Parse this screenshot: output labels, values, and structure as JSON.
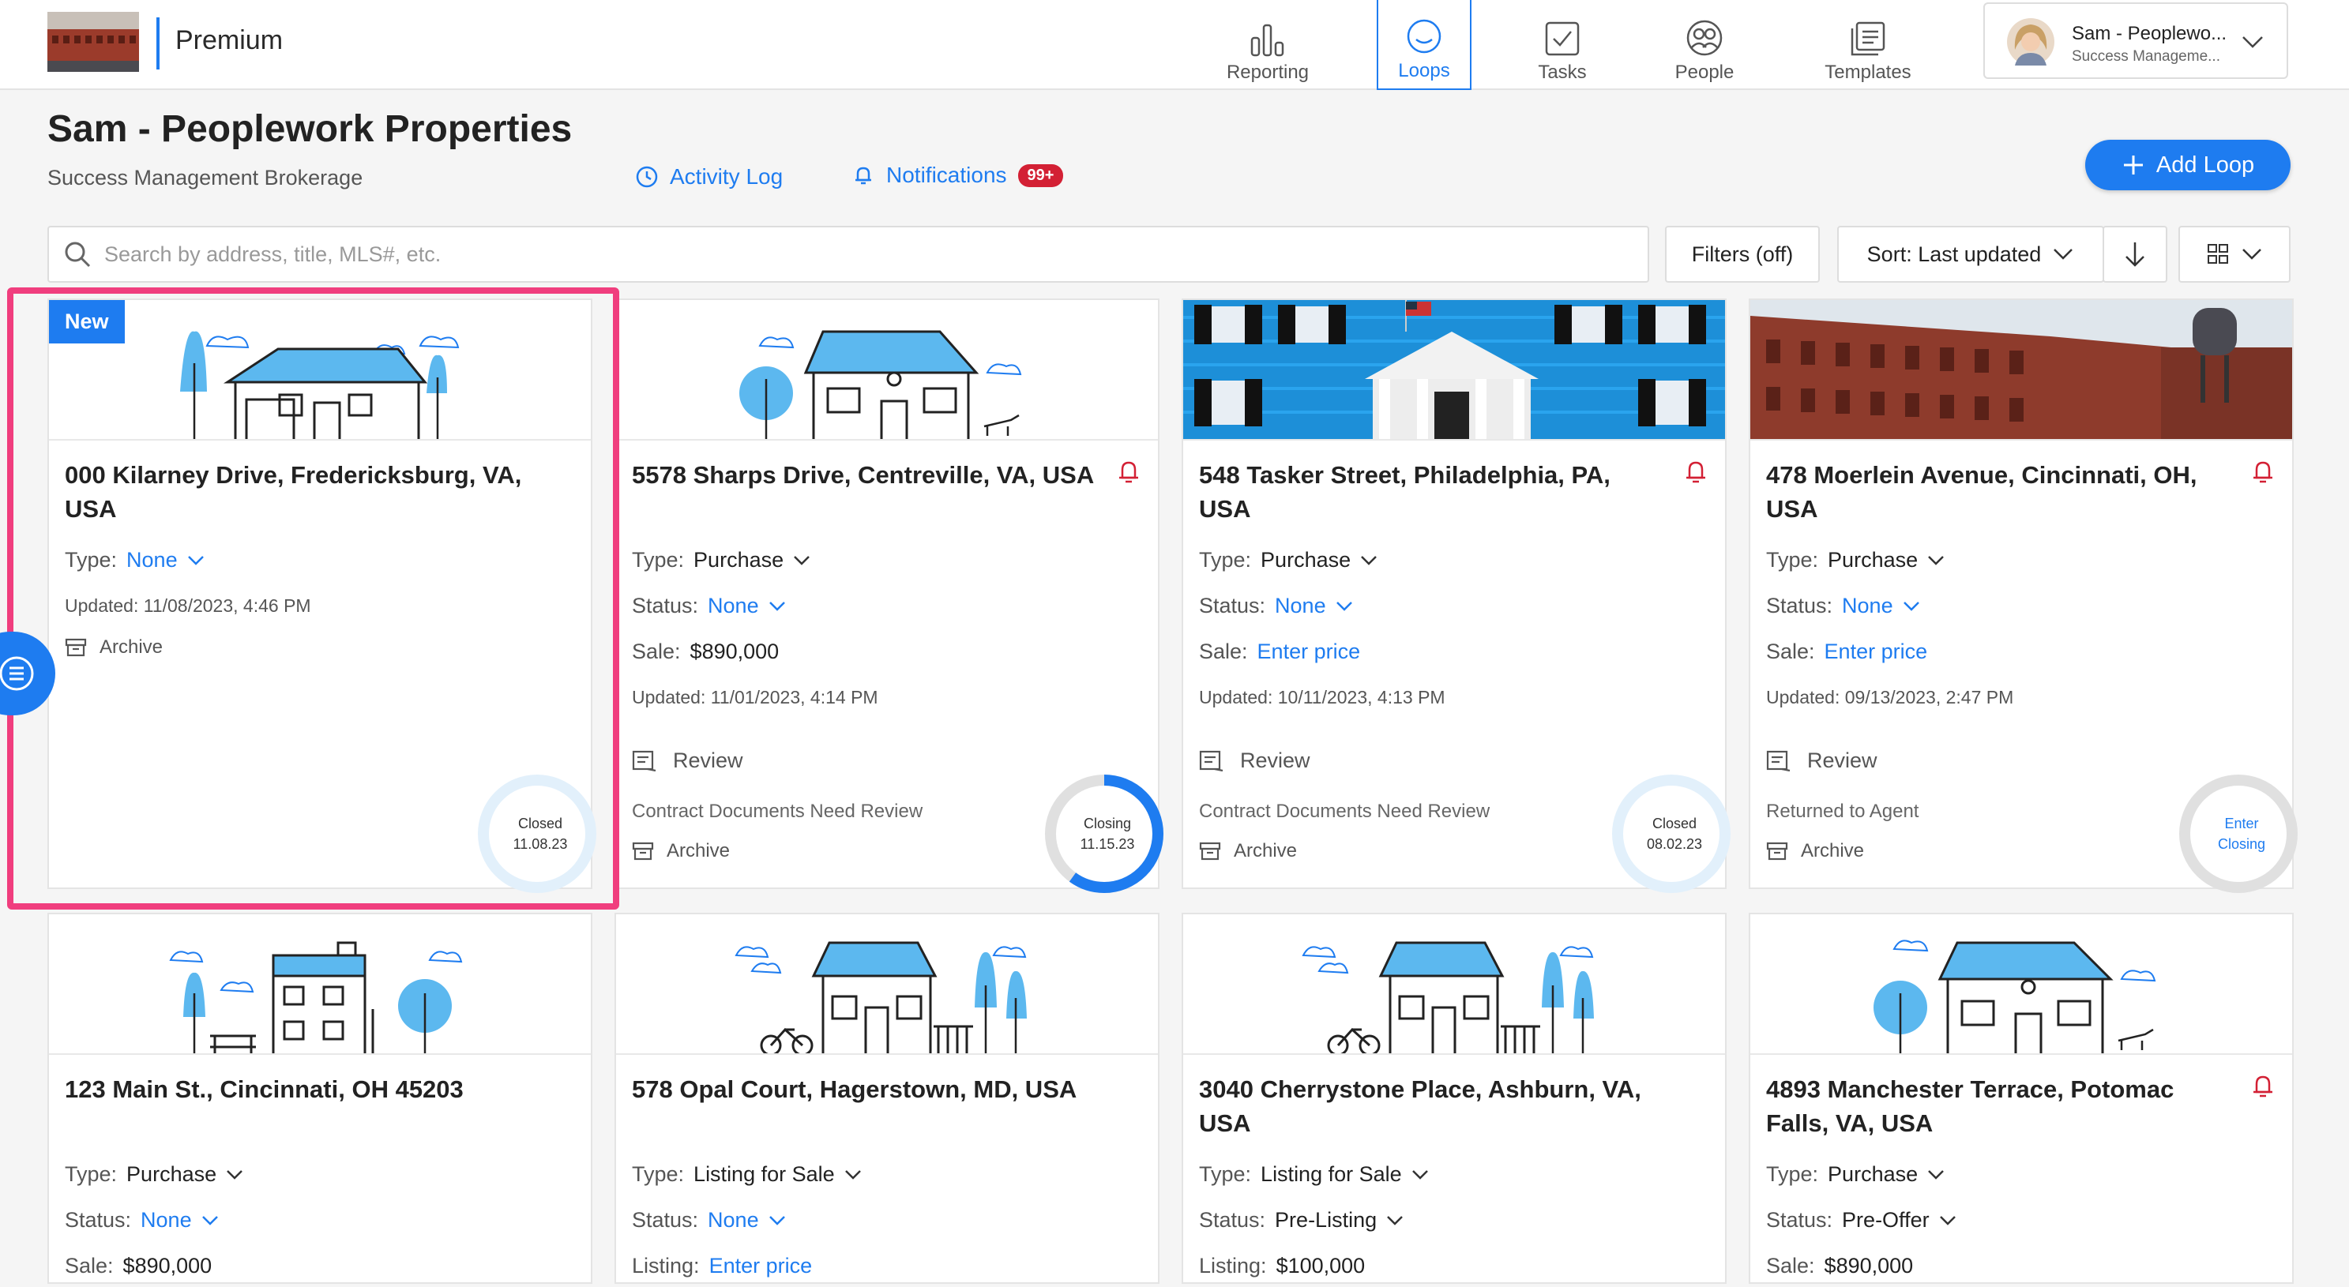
{
  "header": {
    "brand": "Premium",
    "nav": [
      {
        "label": "Reporting",
        "icon": "bar-chart-icon"
      },
      {
        "label": "Loops",
        "icon": "loop-icon",
        "active": true
      },
      {
        "label": "Tasks",
        "icon": "checkbox-icon"
      },
      {
        "label": "People",
        "icon": "people-icon"
      },
      {
        "label": "Templates",
        "icon": "templates-icon"
      }
    ],
    "user": {
      "name": "Sam - Peoplewo...",
      "subtitle": "Success Manageme..."
    }
  },
  "page": {
    "title": "Sam - Peoplework Properties",
    "subtitle": "Success Management Brokerage",
    "activity_log": "Activity Log",
    "notifications": "Notifications",
    "notifications_badge": "99+",
    "add_loop": "Add Loop"
  },
  "toolbar": {
    "search_placeholder": "Search by address, title, MLS#, etc.",
    "filters": "Filters (off)",
    "sort": "Sort: Last updated"
  },
  "colors": {
    "accent": "#1e7cf0",
    "alert": "#d32034",
    "highlight": "#f03e7e"
  },
  "cards": [
    {
      "badge": "New",
      "address": "000 Kilarney Drive, Fredericksburg, VA, USA",
      "type_label": "Type:",
      "type": "None",
      "updated": "Updated: 11/08/2023, 4:46 PM",
      "archive": "Archive",
      "ring_line1": "Closed",
      "ring_line2": "11.08.23"
    },
    {
      "address": "5578 Sharps Drive, Centreville, VA, USA",
      "type_label": "Type:",
      "type": "Purchase",
      "status_label": "Status:",
      "status": "None",
      "sale_label": "Sale:",
      "sale": "$890,000",
      "updated": "Updated: 11/01/2023, 4:14 PM",
      "review": "Review",
      "review_status": "Contract Documents Need Review",
      "archive": "Archive",
      "ring_line1": "Closing",
      "ring_line2": "11.15.23",
      "ring_progress": 0.6
    },
    {
      "address": "548 Tasker Street, Philadelphia, PA, USA",
      "type_label": "Type:",
      "type": "Purchase",
      "status_label": "Status:",
      "status": "None",
      "sale_label": "Sale:",
      "sale": "Enter price",
      "updated": "Updated: 10/11/2023, 4:13 PM",
      "review": "Review",
      "review_status": "Contract Documents Need Review",
      "archive": "Archive",
      "ring_line1": "Closed",
      "ring_line2": "08.02.23"
    },
    {
      "address": "478 Moerlein Avenue, Cincinnati, OH, USA",
      "type_label": "Type:",
      "type": "Purchase",
      "status_label": "Status:",
      "status": "None",
      "sale_label": "Sale:",
      "sale": "Enter price",
      "updated": "Updated: 09/13/2023, 2:47 PM",
      "review": "Review",
      "review_status": "Returned to Agent",
      "archive": "Archive",
      "ring_line1": "Enter",
      "ring_line2": "Closing"
    },
    {
      "address": "123 Main St., Cincinnati, OH 45203",
      "type_label": "Type:",
      "type": "Purchase",
      "status_label": "Status:",
      "status": "None",
      "sale_label": "Sale:",
      "sale": "$890,000"
    },
    {
      "address": "578 Opal Court, Hagerstown, MD, USA",
      "type_label": "Type:",
      "type": "Listing for Sale",
      "status_label": "Status:",
      "status": "None",
      "sale_label": "Listing:",
      "sale": "Enter price"
    },
    {
      "address": "3040 Cherrystone Place, Ashburn, VA, USA",
      "type_label": "Type:",
      "type": "Listing for Sale",
      "status_label": "Status:",
      "status": "Pre-Listing",
      "sale_label": "Listing:",
      "sale": "$100,000"
    },
    {
      "address": "4893 Manchester Terrace, Potomac Falls, VA, USA",
      "type_label": "Type:",
      "type": "Purchase",
      "status_label": "Status:",
      "status": "Pre-Offer",
      "sale_label": "Sale:",
      "sale": "$890,000"
    }
  ]
}
